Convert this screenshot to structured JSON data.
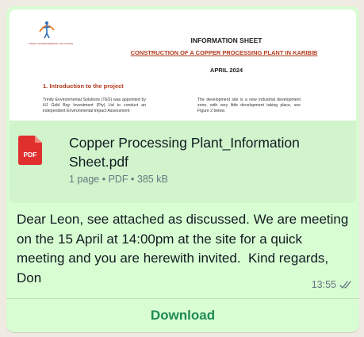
{
  "attachment": {
    "preview": {
      "logo_text": "TRINITY ENVIRONMENTAL SOLUTIONS",
      "heading": "INFORMATION SHEET",
      "subheading": "CONSTRUCTION OF A COPPER PROCESSING PLANT IN KARIBIB",
      "date": "APRIL 2024",
      "section": "1. Introduction to the project",
      "left_column": "Trinity Environmental Solutions (TES) was appointed by HJ Gold Bay Investment (Pty) Ltd to conduct an independent Environmental Impact Assessment",
      "right_column": "The development site is a new industrial development zone, with very little development taking place, see Figure 2 below."
    },
    "file_name": "Copper Processing Plant_Information Sheet.pdf",
    "icon_label": "PDF",
    "pages": "1 page",
    "type": "PDF",
    "size": "385 kB",
    "separator": " • "
  },
  "message": {
    "text": "Dear Leon, see attached as discussed. We are meeting on the 15 April at 14:00pm at the site for a quick meeting and you are herewith invited.  Kind regards,  Don",
    "time": "13:55",
    "status_icon": "double-check-icon"
  },
  "download_label": "Download",
  "colors": {
    "bubble": "#d9fdd3",
    "attachment_bg": "#d1f4cc",
    "pdf_red": "#e0302d",
    "download_green": "#1f8a55",
    "meta_gray": "#667781"
  }
}
